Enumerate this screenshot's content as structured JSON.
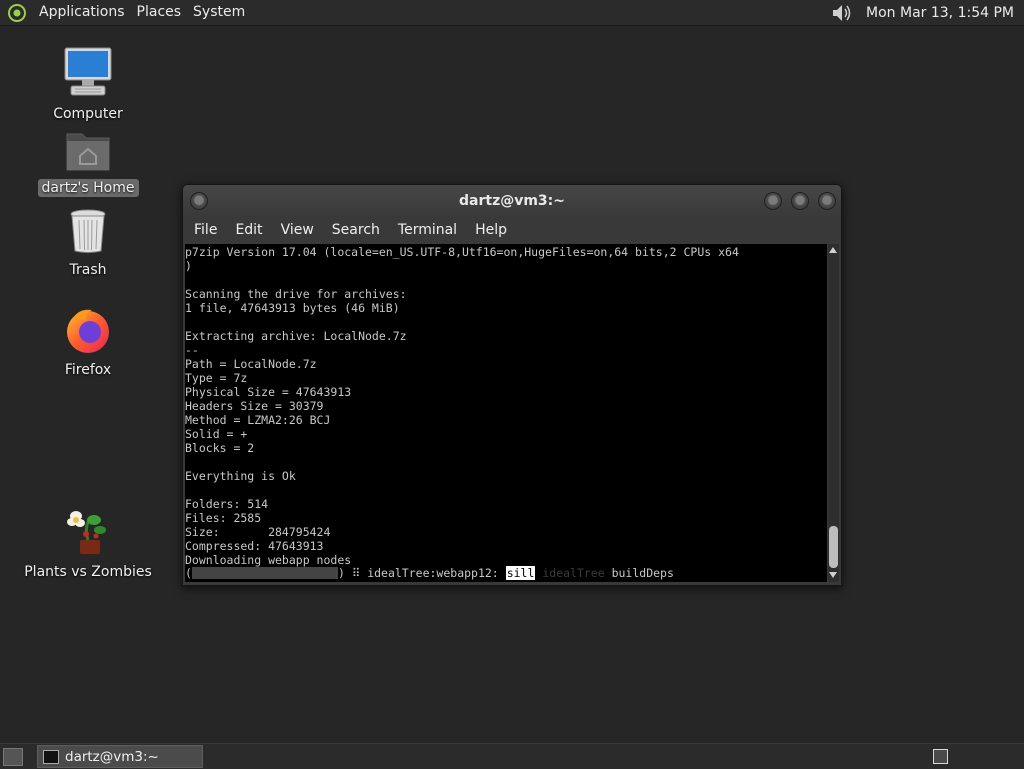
{
  "top_panel": {
    "menus": [
      "Applications",
      "Places",
      "System"
    ],
    "clock": "Mon Mar 13,  1:54 PM"
  },
  "desktop_icons": [
    {
      "label": "Computer",
      "icon": "computer-icon"
    },
    {
      "label": "dartz's Home",
      "icon": "home-folder-icon",
      "selected": true
    },
    {
      "label": "Trash",
      "icon": "trash-icon"
    },
    {
      "label": "Firefox",
      "icon": "firefox-icon"
    },
    {
      "label": "Plants vs Zombies",
      "icon": "plants-vs-zombies-icon"
    }
  ],
  "terminal": {
    "title": "dartz@vm3:~",
    "menu": [
      "File",
      "Edit",
      "View",
      "Search",
      "Terminal",
      "Help"
    ],
    "output": "p7zip Version 17.04 (locale=en_US.UTF-8,Utf16=on,HugeFiles=on,64 bits,2 CPUs x64\n)\n\nScanning the drive for archives:\n1 file, 47643913 bytes (46 MiB)\n\nExtracting archive: LocalNode.7z\n--\nPath = LocalNode.7z\nType = 7z\nPhysical Size = 47643913\nHeaders Size = 30379\nMethod = LZMA2:26 BCJ\nSolid = +\nBlocks = 2\n\nEverything is Ok\n\nFolders: 514\nFiles: 2585\nSize:       284795424\nCompressed: 47643913\nDownloading webapp nodes",
    "status": {
      "open": "(",
      "progress": 0.0,
      "close": ")",
      "spinner": "⠿",
      "task": "idealTree:webapp12:",
      "level": "sill",
      "faded": "idealTree",
      "message": "buildDeps"
    }
  },
  "taskbar": {
    "window_label": "dartz@vm3:~"
  }
}
